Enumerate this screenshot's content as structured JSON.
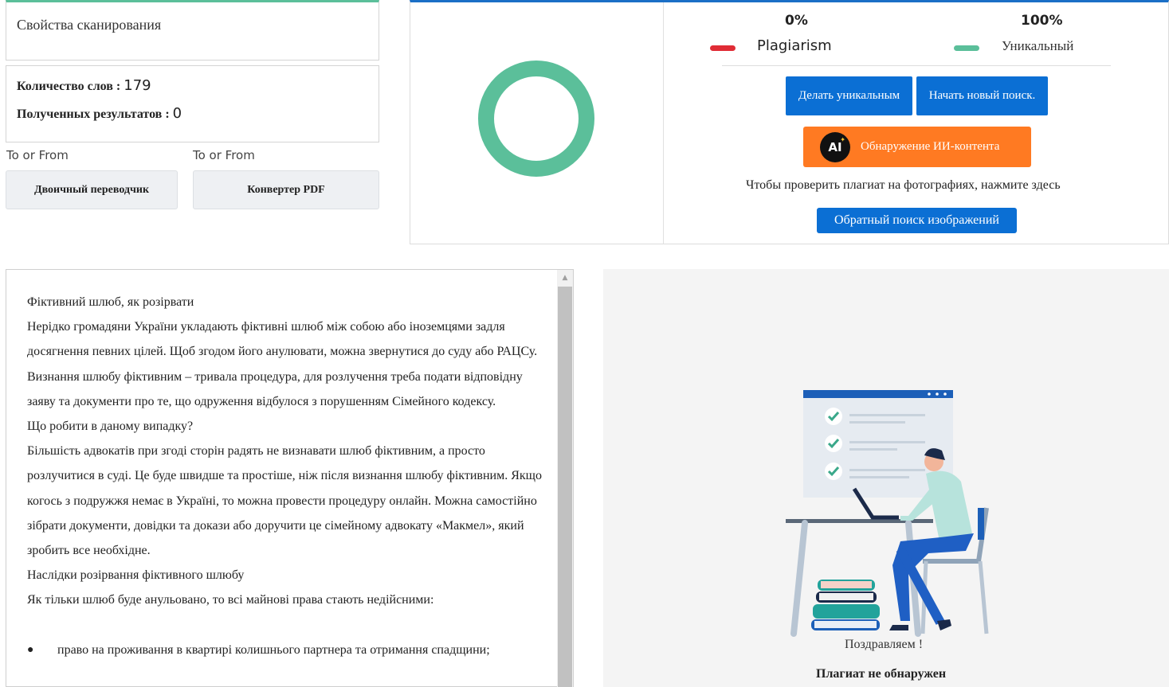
{
  "scan": {
    "title": "Свойства сканирования"
  },
  "stats": {
    "words_label": "Количество слов :",
    "words_value": "179",
    "results_label": "Полученных результатов :",
    "results_value": "0"
  },
  "tools": {
    "to_from_1": "To or From",
    "to_from_2": "To or From",
    "binary_label": "Двоичный переводчик",
    "pdf_label": "Конвертер PDF"
  },
  "result": {
    "plagiarism_pct": "0%",
    "unique_pct": "100%",
    "plagiarism_label": "Plagiarism",
    "unique_label": "Уникальный",
    "make_unique_label": "Делать уникальным",
    "new_search_label": "Начать новый поиск.",
    "ai_badge": "AI",
    "ai_detect_label": "Обнаружение ИИ-контента",
    "photo_text": "Чтобы проверить плагиат на фотографиях, нажмите здесь",
    "reverse_image_label": "Обратный поиск изображений",
    "plagiarism_fraction": 0.0,
    "colors": {
      "plagiarism": "#e02c35",
      "unique": "#5bbf9a",
      "accent": "#0b6fd4",
      "ai": "#ff7a22"
    }
  },
  "document": {
    "lines": [
      "Фіктивний шлюб, як розірвати",
      "Нерідко громадяни України укладають фіктивні шлюб між собою або іноземцями задля досягнення певних цілей. Щоб згодом його анулювати, можна звернутися до суду або РАЦСу. Визнання шлюбу фіктивним – тривала процедура, для розлучення треба подати відповідну заяву та документи про те, що одруження відбулося з порушенням Сімейного кодексу.",
      "Що робити в даному випадку?",
      "Більшість адвокатів при згоді сторін радять не визнавати шлюб фіктивним, а просто розлучитися в суді. Це буде швидше та простіше, ніж після визнання шлюбу фіктивним. Якщо когось з подружжя немає в Україні, то можна провести процедуру онлайн. Можна самостійно зібрати документи, довідки та докази або доручити це сімейному адвокату «Макмел», який зробить все необхідне.",
      "Наслідки розірвання фіктивного шлюбу",
      "Як тільки шлюб буде анульовано, то всі майнові права стають недійсними:"
    ],
    "bullets": [
      "право на проживання в квартирі колишнього партнера та отримання спадщини;"
    ]
  },
  "illustration": {
    "congrats": "Поздравляем !",
    "no_plagiarism": "Плагиат не обнаружен"
  }
}
